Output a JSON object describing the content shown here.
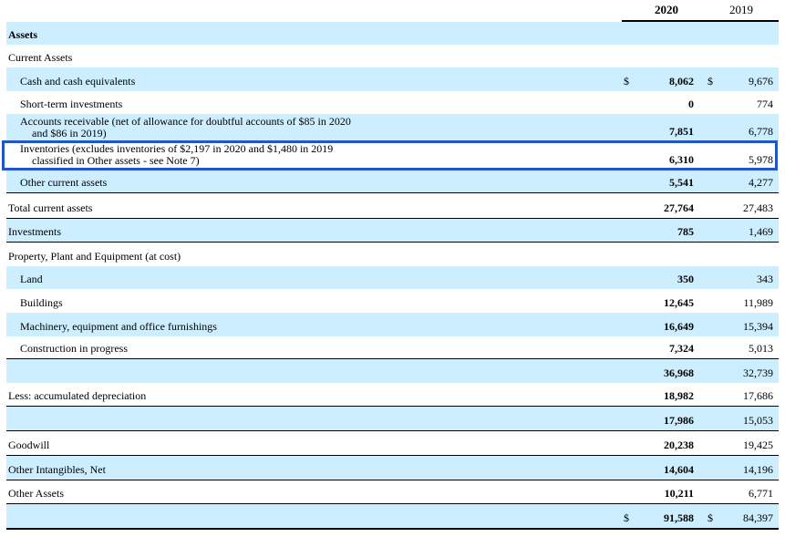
{
  "header": {
    "year_2020": "2020",
    "year_2019": "2019"
  },
  "rows": [
    {
      "label": "Assets",
      "bold": true,
      "indent": false,
      "v2020": "",
      "v2019": "",
      "blue": true
    },
    {
      "label": "Current Assets",
      "indent": false,
      "v2020": "",
      "v2019": "",
      "blue": false
    },
    {
      "label": "Cash and cash equivalents",
      "indent": true,
      "dollar2020": "$",
      "v2020": "8,062",
      "dollar2019": "$",
      "v2019": "9,676",
      "blue": true
    },
    {
      "label": "Short-term investments",
      "indent": true,
      "v2020": "0",
      "v2019": "774",
      "blue": false
    },
    {
      "label": "Accounts receivable (net of allowance for doubtful accounts of $85 in 2020",
      "label2": "and $86 in 2019)",
      "indent": true,
      "v2020": "7,851",
      "v2019": "6,778",
      "blue": true
    },
    {
      "label": "Inventories (excludes inventories of $2,197 in 2020 and $1,480 in 2019",
      "label2": "classified in Other assets - see Note 7)",
      "indent": true,
      "v2020": "6,310",
      "v2019": "5,978",
      "blue": false
    },
    {
      "label": "Other current assets",
      "indent": true,
      "v2020": "5,541",
      "v2019": "4,277",
      "blue": true
    },
    {
      "label": "Total current assets",
      "indent": false,
      "v2020": "27,764",
      "v2019": "27,483",
      "blue": false
    },
    {
      "label": "Investments",
      "indent": false,
      "v2020": "785",
      "v2019": "1,469",
      "blue": true
    },
    {
      "label": "Property, Plant and Equipment (at cost)",
      "indent": false,
      "v2020": "",
      "v2019": "",
      "blue": false
    },
    {
      "label": "Land",
      "indent": true,
      "v2020": "350",
      "v2019": "343",
      "blue": true
    },
    {
      "label": "Buildings",
      "indent": true,
      "v2020": "12,645",
      "v2019": "11,989",
      "blue": false
    },
    {
      "label": "Machinery, equipment and office furnishings",
      "indent": true,
      "v2020": "16,649",
      "v2019": "15,394",
      "blue": true
    },
    {
      "label": "Construction in progress",
      "indent": true,
      "v2020": "7,324",
      "v2019": "5,013",
      "blue": false
    },
    {
      "label": "",
      "indent": false,
      "v2020": "36,968",
      "v2019": "32,739",
      "blue": true
    },
    {
      "label": "Less: accumulated depreciation",
      "indent": false,
      "v2020": "18,982",
      "v2019": "17,686",
      "blue": false
    },
    {
      "label": "",
      "indent": false,
      "v2020": "17,986",
      "v2019": "15,053",
      "blue": true
    },
    {
      "label": "Goodwill",
      "indent": false,
      "v2020": "20,238",
      "v2019": "19,425",
      "blue": false
    },
    {
      "label": "Other Intangibles, Net",
      "indent": false,
      "v2020": "14,604",
      "v2019": "14,196",
      "blue": true
    },
    {
      "label": "Other Assets",
      "indent": false,
      "v2020": "10,211",
      "v2019": "6,771",
      "blue": false
    },
    {
      "label": "",
      "indent": false,
      "dollar2020": "$",
      "v2020": "91,588",
      "dollar2019": "$",
      "v2019": "84,397",
      "blue": true
    }
  ],
  "highlight": {
    "row": "Inventories",
    "color": "#2255cc"
  },
  "colors": {
    "row_blue": "#cceeff"
  }
}
